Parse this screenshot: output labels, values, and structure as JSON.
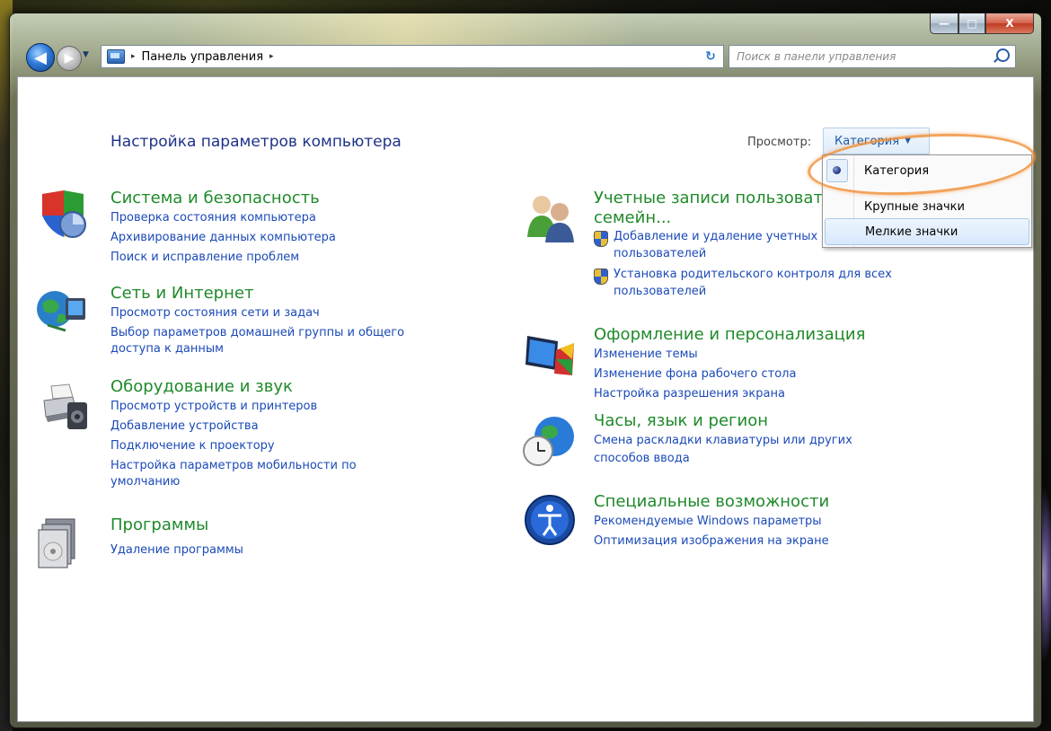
{
  "window": {
    "title": "Панель управления"
  },
  "caption": {
    "min": "—",
    "max": "□",
    "close": "X"
  },
  "nav": {
    "back": "◀",
    "forward": "▶",
    "history": "▼",
    "breadcrumb": "Панель управления",
    "sep1": "▸",
    "sep2": "▸",
    "dropdown": "▼",
    "refresh": "↻",
    "search_placeholder": "Поиск в панели управления"
  },
  "main": {
    "title": "Настройка параметров компьютера",
    "view_label": "Просмотр:",
    "view_value": "Категория",
    "view_arrow": "▼"
  },
  "view_menu": {
    "items": [
      {
        "label": "Категория",
        "selected": true
      },
      {
        "label": "Крупные значки"
      },
      {
        "label": "Мелкие значки"
      }
    ]
  },
  "categories": {
    "system": {
      "icon": "shield-icon",
      "title": "Система и безопасность",
      "links": [
        "Проверка состояния компьютера",
        "Архивирование данных компьютера",
        "Поиск и исправление проблем"
      ]
    },
    "network": {
      "icon": "globe-network-icon",
      "title": "Сеть и Интернет",
      "links": [
        "Просмотр состояния сети и задач",
        "Выбор параметров домашней группы и общего",
        "доступа к данным"
      ]
    },
    "hardware": {
      "icon": "printer-icon",
      "title": "Оборудование и звук",
      "links": [
        "Просмотр устройств и принтеров",
        "Добавление устройства",
        "Подключение к проектору",
        "Настройка параметров мобильности по",
        "умолчанию"
      ]
    },
    "programs": {
      "icon": "programs-icon",
      "title": "Программы",
      "links": [
        "Удаление программы"
      ]
    },
    "accounts": {
      "icon": "users-icon",
      "title_line1": "Учетные записи пользоват",
      "title_line2": "семейн...",
      "links": [
        "Добавление и удаление учетных",
        "пользователей",
        "Установка родительского контроля для всех",
        "пользователей"
      ]
    },
    "appearance": {
      "icon": "display-icon",
      "title": "Оформление и персонализация",
      "links": [
        "Изменение темы",
        "Изменение фона рабочего стола",
        "Настройка разрешения экрана"
      ]
    },
    "clock": {
      "icon": "clock-globe-icon",
      "title": "Часы, язык и регион",
      "links": [
        "Смена раскладки клавиатуры или других",
        "способов ввода"
      ]
    },
    "access": {
      "icon": "accessibility-icon",
      "title": "Специальные возможности",
      "links": [
        "Рекомендуемые Windows параметры",
        "Оптимизация изображения на экране"
      ]
    }
  },
  "colors": {
    "category_title": "#1f8a2a",
    "link": "#1b4ab8",
    "page_title": "#1e3287",
    "highlight": "#f08c32"
  }
}
